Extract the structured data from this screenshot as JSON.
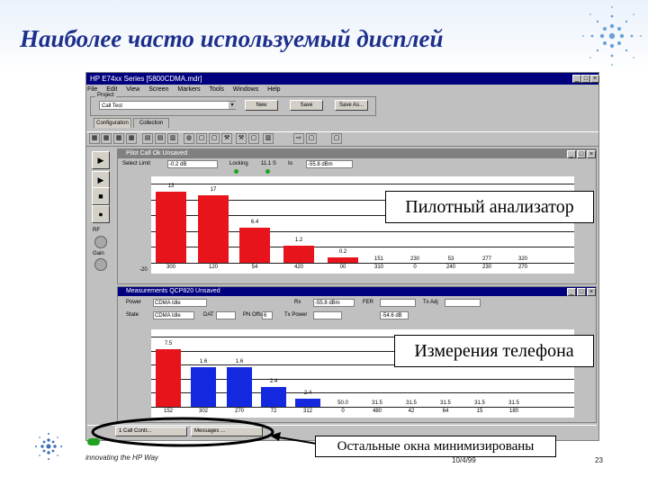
{
  "slide": {
    "title": "Наиболее часто используемый дисплей",
    "footer_tagline": "innovating the HP Way",
    "footer_date": "10/4/99",
    "page_number": "23"
  },
  "app": {
    "title": "HP E74xx Series [5800CDMA.mdr]",
    "menu": [
      "File",
      "Edit",
      "View",
      "Screen",
      "Markers",
      "Tools",
      "Windows",
      "Help"
    ],
    "project_label": "Project",
    "project_value": "Call Test",
    "project_buttons": [
      "New",
      "Save",
      "Save As..."
    ],
    "tabs": [
      "Configuration",
      "Collection"
    ],
    "window_controls": [
      "_",
      "□",
      "×"
    ]
  },
  "pilot_window": {
    "title": "Pilot     Call Ok     Unsaved",
    "fields": [
      {
        "label": "Select Limit",
        "value": "-0.2 dB"
      },
      {
        "label": "Locking",
        "value": "11.1 S"
      },
      {
        "label": "Io",
        "value": "-55.8 dBm"
      }
    ],
    "bars": [
      {
        "label": "13",
        "pn": "300",
        "value": 13,
        "color": "#e8141c"
      },
      {
        "label": "17",
        "pn": "120",
        "value": 12.3,
        "color": "#e8141c"
      },
      {
        "label": "6.4",
        "pn": "54",
        "value": 6.4,
        "color": "#e8141c"
      },
      {
        "label": "1.2",
        "pn": "420",
        "value": 3.2,
        "color": "#e8141c"
      },
      {
        "label": "0.2",
        "pn": "00",
        "value": 1.0,
        "color": "#e8141c"
      }
    ],
    "extra_categories": [
      {
        "top": "151",
        "bottom": "310"
      },
      {
        "top": "230",
        "bottom": "0"
      },
      {
        "top": "53",
        "bottom": "240"
      },
      {
        "top": "277",
        "bottom": "230"
      },
      {
        "top": "320",
        "bottom": "270"
      }
    ],
    "y_axis_label": "-20"
  },
  "measure_window": {
    "title": "Measurements      QCP820      Unsaved",
    "fields_row1": [
      {
        "label": "Power",
        "value": "CDMA Idle"
      },
      {
        "label": "Rx",
        "value": "-55.8 dBm"
      },
      {
        "label": "FER",
        "value": ""
      },
      {
        "label": "Tx Adj",
        "value": ""
      }
    ],
    "fields_row2": [
      {
        "label": "State",
        "value": "CDMA Idle"
      },
      {
        "label": "DAT",
        "value": ""
      },
      {
        "label": "PN Offset",
        "value": "6"
      },
      {
        "label": "Tx Power",
        "value": ""
      },
      {
        "label": "",
        "value": "-54.6 dB"
      }
    ],
    "bars": [
      {
        "label": "7.5",
        "pn": "152",
        "value": 7.5,
        "color": "#e8141c"
      },
      {
        "label": "1.6",
        "pn": "302",
        "value": 5.2,
        "color": "#1428e0"
      },
      {
        "label": "1.6",
        "pn": "270",
        "value": 5.2,
        "color": "#1428e0"
      },
      {
        "label": "2.4",
        "pn": "72",
        "value": 2.6,
        "color": "#1428e0"
      },
      {
        "label": "2.4",
        "pn": "312",
        "value": 1.1,
        "color": "#1428e0"
      }
    ],
    "extra_categories": [
      {
        "top": "50.0",
        "bottom": "0"
      },
      {
        "top": "31.5",
        "bottom": "480"
      },
      {
        "top": "31.5",
        "bottom": "42"
      },
      {
        "top": "31.5",
        "bottom": "64"
      },
      {
        "top": "31.5",
        "bottom": "15"
      },
      {
        "top": "31.5",
        "bottom": "180"
      }
    ]
  },
  "callouts": {
    "pilot": "Пилотный анализатор",
    "phone": "Измерения телефона",
    "minimized": "Остальные окна минимизированы"
  },
  "taskbar": {
    "items": [
      "1 Call Contr...",
      "Messages ..."
    ]
  },
  "side_controls": {
    "buttons": [
      "▶",
      "▶",
      "■",
      "●"
    ],
    "knob_labels": [
      "RF",
      "Gain"
    ]
  },
  "toolbar_icons": [
    "grid-icon",
    "grid-icon",
    "grid-icon",
    "grid-icon",
    "table-icon",
    "table-icon",
    "chart-icon",
    "globe-icon",
    "doc-icon",
    "doc-icon",
    "tools-icon",
    "tools-icon",
    "doc-icon",
    "chart-icon",
    "arrow-icon",
    "doc-icon",
    "doc-icon"
  ],
  "colors": {
    "title_blue": "#1d2f8c",
    "red_bar": "#e8141c",
    "blue_bar": "#1428e0",
    "window_active": "#00007f"
  }
}
